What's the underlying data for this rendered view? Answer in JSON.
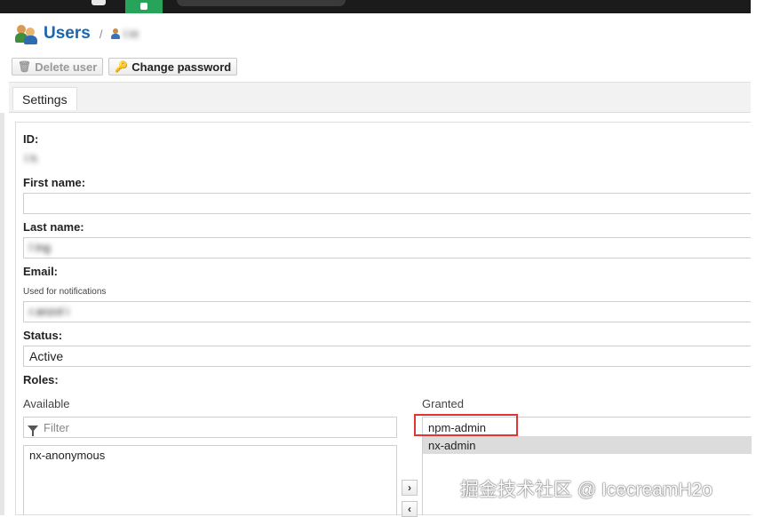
{
  "header": {
    "title": "Users",
    "separator": "/",
    "breadcrumb_user": "l  H"
  },
  "toolbar": {
    "delete_label": "Delete user",
    "change_password_label": "Change password"
  },
  "tabs": [
    {
      "label": "Settings"
    }
  ],
  "form": {
    "id": {
      "label": "ID:",
      "value": "l h"
    },
    "first_name": {
      "label": "First name:",
      "value": ""
    },
    "last_name": {
      "label": "Last name:",
      "value": "l ing"
    },
    "email": {
      "label": "Email:",
      "hint": "Used for notifications",
      "value": "r.anzol i"
    },
    "status": {
      "label": "Status:",
      "value": "Active"
    },
    "roles": {
      "label": "Roles:",
      "available_header": "Available",
      "granted_header": "Granted",
      "filter_placeholder": "Filter",
      "available": [
        "nx-anonymous"
      ],
      "granted": [
        "npm-admin",
        "nx-admin"
      ],
      "move_right": "›",
      "move_left": "‹"
    }
  },
  "watermark": "掘金技术社区 @ IcecreamH2o",
  "colors": {
    "title": "#1b66ad",
    "highlight": "#e03535",
    "topbar": "#1b1b1b",
    "topbar_accent": "#27a35a"
  }
}
